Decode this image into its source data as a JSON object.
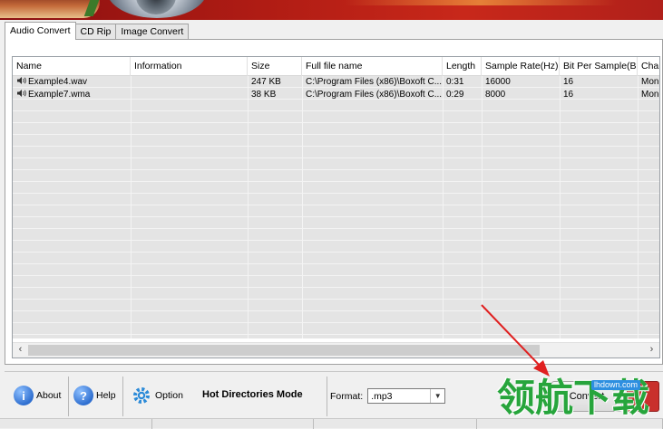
{
  "tabs": [
    {
      "label": "Audio Convert",
      "active": true
    },
    {
      "label": "CD Rip",
      "active": false
    },
    {
      "label": "Image Convert",
      "active": false
    }
  ],
  "columns": [
    "Name",
    "Information",
    "Size",
    "Full file name",
    "Length",
    "Sample Rate(Hz)",
    "Bit Per Sample(Bit)",
    "Char"
  ],
  "files": [
    {
      "name": "Example4.wav",
      "information": "",
      "size": "247 KB",
      "full_file_name": "C:\\Program Files (x86)\\Boxoft C...",
      "length": "0:31",
      "sample_rate": "16000",
      "bit_per_sample": "16",
      "channels": "Mono"
    },
    {
      "name": "Example7.wma",
      "information": "",
      "size": "38 KB",
      "full_file_name": "C:\\Program Files (x86)\\Boxoft C...",
      "length": "0:29",
      "sample_rate": "8000",
      "bit_per_sample": "16",
      "channels": "Mono"
    }
  ],
  "scrollbar": {
    "left_arrow": "‹",
    "right_arrow": "›"
  },
  "toolbar": {
    "about_label": "About",
    "help_label": "Help",
    "option_label": "Option",
    "mode_label": "Hot Directories Mode",
    "format_label": "Format:",
    "format_value": ".mp3",
    "convert_label": "Convert"
  },
  "icons": {
    "about": "info-icon",
    "help": "question-icon",
    "option": "gear-icon",
    "file": "speaker-icon"
  },
  "colors": {
    "banner": "#b01c14",
    "about_icon": "#2f6fd0",
    "help_icon": "#2f6fd0",
    "option_icon": "#2a8ad8",
    "annotation_arrow": "#e02020",
    "watermark": "#27a53c"
  },
  "watermark": {
    "text": "领航下载",
    "url": "lhdown.com"
  }
}
